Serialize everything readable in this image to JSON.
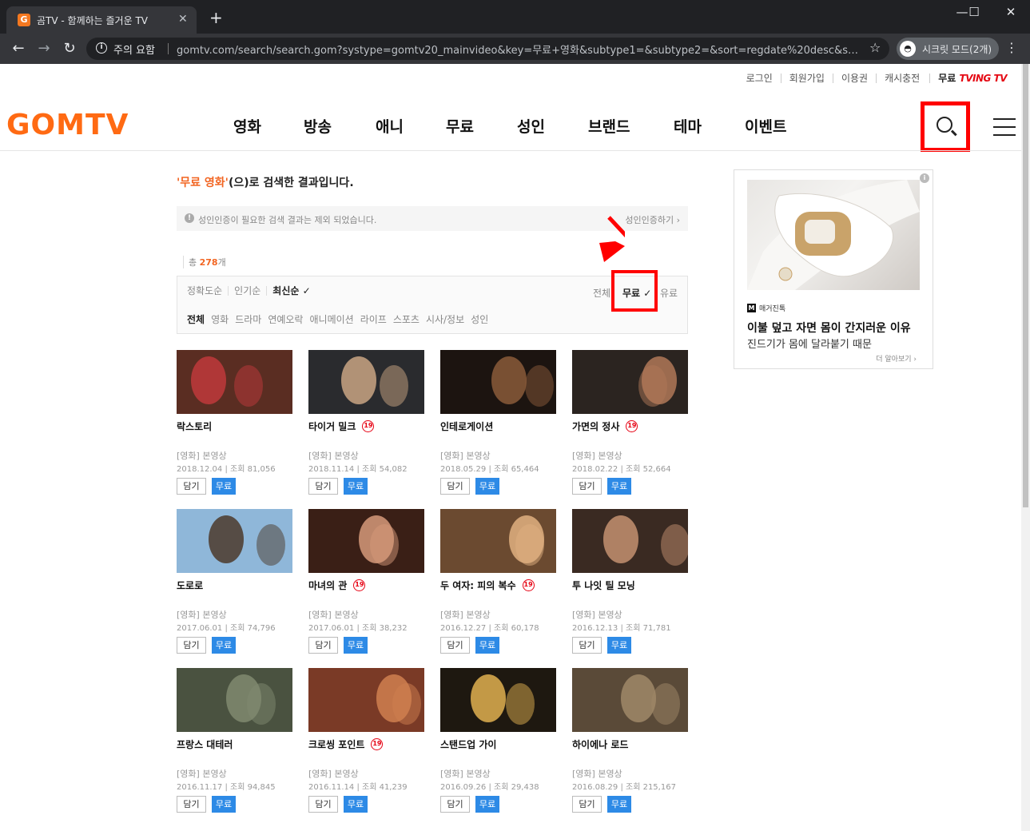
{
  "browser": {
    "tab_title": "곰TV - 함께하는 즐거운 TV",
    "tab_favicon": "G",
    "tab_close": "✕",
    "new_tab": "+",
    "security_warning": "주의 요함",
    "url": "gomtv.com/search/search.gom?systype=gomtv20_mainvideo&key=무료+영화&subtype1=&subtype2=&sort=regdate%20desc&subt...",
    "incognito_label": "시크릿 모드(2개)"
  },
  "util_links": [
    "로그인",
    "회원가입",
    "이용권",
    "캐시충전"
  ],
  "tving": {
    "prefix": "무료",
    "brand": "TVING TV"
  },
  "logo": "GOMTV",
  "gnb": [
    "영화",
    "방송",
    "애니",
    "무료",
    "성인",
    "브랜드",
    "테마",
    "이벤트"
  ],
  "result": {
    "keyword": "'무료 영화'",
    "suffix": "(으)로 검색한 결과입니다."
  },
  "notice": {
    "text": "성인인증이 필요한 검색 결과는 제외 되었습니다.",
    "link": "성인인증하기 ›"
  },
  "total": {
    "prefix": "총",
    "count": "278",
    "suffix": "개"
  },
  "sort": {
    "accuracy": "정확도순",
    "popular": "인기순",
    "latest": "최신순 ✓"
  },
  "price": {
    "all": "전체",
    "free": "무료 ✓",
    "paid": "유료"
  },
  "categories": [
    "전체",
    "영화",
    "드라마",
    "연예오락",
    "애니메이션",
    "라이프",
    "스포츠",
    "시사/정보",
    "성인"
  ],
  "buttons": {
    "dam": "담기",
    "free": "무료"
  },
  "age_badge": "19",
  "movies": [
    {
      "title": "락스토리",
      "genre": "[영화] 본영상",
      "date": "2018.12.04",
      "views": "조회 81,056",
      "adult": false,
      "bg": "#5a2d22",
      "accent": "#c0393b"
    },
    {
      "title": "타이거 밀크",
      "genre": "[영화] 본영상",
      "date": "2018.11.14",
      "views": "조회 54,082",
      "adult": true,
      "bg": "#2a2b2e",
      "accent": "#c9a582"
    },
    {
      "title": "인테로게이션",
      "genre": "[영화] 본영상",
      "date": "2018.05.29",
      "views": "조회 65,464",
      "adult": false,
      "bg": "#1c1410",
      "accent": "#8a5a3a"
    },
    {
      "title": "가면의 정사",
      "genre": "[영화] 본영상",
      "date": "2018.02.22",
      "views": "조회 52,664",
      "adult": true,
      "bg": "#2b2420",
      "accent": "#b07858"
    },
    {
      "title": "도로로",
      "genre": "[영화] 본영상",
      "date": "2017.06.01",
      "views": "조회 74,796",
      "adult": false,
      "bg": "#8fb7d9",
      "accent": "#4c3a2a"
    },
    {
      "title": "마녀의 관",
      "genre": "[영화] 본영상",
      "date": "2017.06.01",
      "views": "조회 38,232",
      "adult": true,
      "bg": "#3a1f16",
      "accent": "#d69a7a"
    },
    {
      "title": "두 여자: 피의 복수",
      "genre": "[영화] 본영상",
      "date": "2016.12.27",
      "views": "조회 60,178",
      "adult": true,
      "bg": "#6b4a30",
      "accent": "#e0b080"
    },
    {
      "title": "투 나잇 틸 모닝",
      "genre": "[영화] 본영상",
      "date": "2016.12.13",
      "views": "조회 71,781",
      "adult": false,
      "bg": "#3a2a22",
      "accent": "#c49070"
    },
    {
      "title": "프랑스 대테러",
      "genre": "[영화] 본영상",
      "date": "2016.11.17",
      "views": "조회 94,845",
      "adult": false,
      "bg": "#4a5240",
      "accent": "#808a70"
    },
    {
      "title": "크로씽 포인트",
      "genre": "[영화] 본영상",
      "date": "2016.11.14",
      "views": "조회 41,239",
      "adult": true,
      "bg": "#7a3a26",
      "accent": "#d08050"
    },
    {
      "title": "스탠드업 가이",
      "genre": "[영화] 본영상",
      "date": "2016.09.26",
      "views": "조회 29,438",
      "adult": false,
      "bg": "#1e1810",
      "accent": "#e0b050"
    },
    {
      "title": "하이에나 로드",
      "genre": "[영화] 본영상",
      "date": "2016.08.29",
      "views": "조회 215,167",
      "adult": false,
      "bg": "#5a4a38",
      "accent": "#a08868"
    }
  ],
  "ad": {
    "info": "i",
    "brand_mark": "M",
    "brand": "매거진톡",
    "headline": "이불 덮고 자면 몸이 간지러운 이유",
    "subline": "진드기가 몸에 달라붙기 때문",
    "more": "더 알아보기 ›"
  },
  "colors": {
    "brand_orange": "#ff6a13",
    "highlight_red": "#ff0000",
    "free_blue": "#2d8ae6"
  }
}
